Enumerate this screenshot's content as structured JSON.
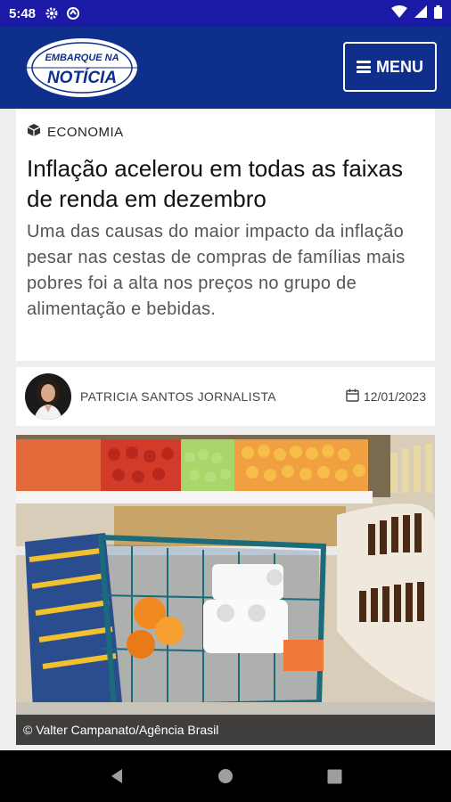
{
  "status_bar": {
    "time": "5:48"
  },
  "header": {
    "logo_top": "EMBARQUE NA",
    "logo_bottom": "NOTÍCIA",
    "menu_label": "MENU"
  },
  "article": {
    "category": "ECONOMIA",
    "headline": "Inflação acelerou em todas as faixas de renda em dezembro",
    "summary": "Uma das causas do maior impacto da inflação pesar nas cestas de compras de famílias mais pobres foi a alta nos preços no grupo de alimentação e bebidas.",
    "author": "PATRICIA SANTOS JORNALISTA",
    "date": "12/01/2023",
    "photo_caption": "© Valter Campanato/Agência Brasil"
  }
}
